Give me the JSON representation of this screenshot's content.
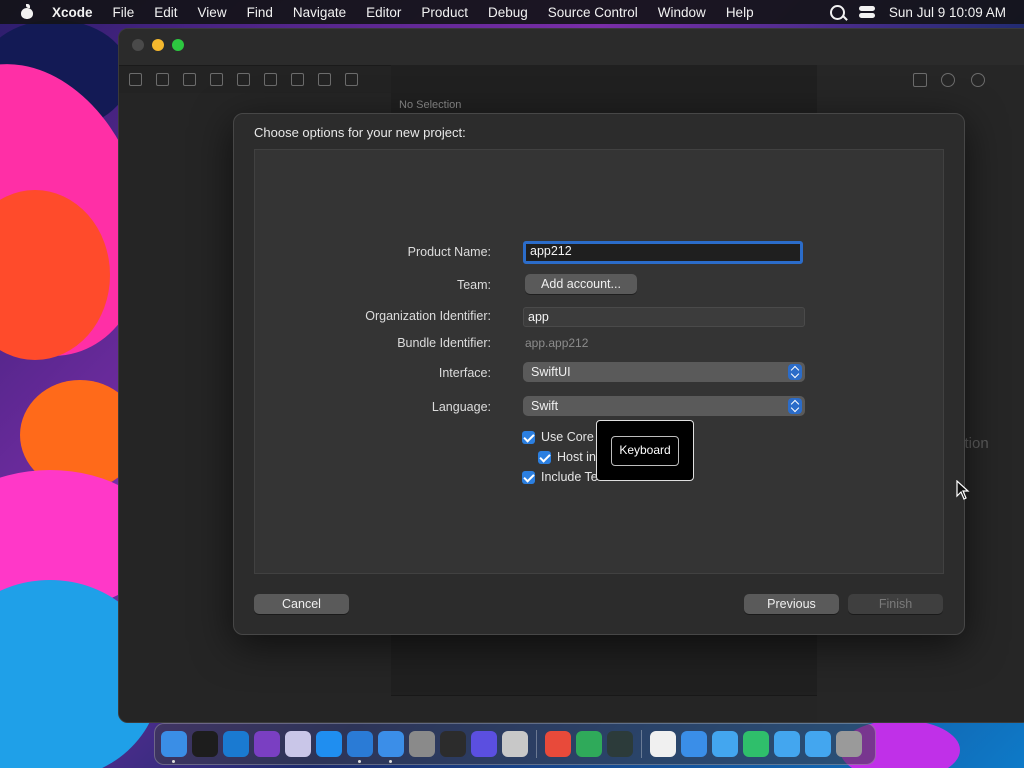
{
  "menubar": {
    "app_name": "Xcode",
    "items": [
      "File",
      "Edit",
      "View",
      "Find",
      "Navigate",
      "Editor",
      "Product",
      "Debug",
      "Source Control",
      "Window",
      "Help"
    ],
    "clock": "Sun Jul 9  10:09 AM"
  },
  "xcode": {
    "center_placeholder": "No Selection",
    "inspector_placeholder": "ction"
  },
  "sheet": {
    "title": "Choose options for your new project:",
    "product_name": {
      "label": "Product Name:",
      "value": "app212"
    },
    "team": {
      "label": "Team:",
      "button": "Add account..."
    },
    "org_id": {
      "label": "Organization Identifier:",
      "value": "app"
    },
    "bundle_id": {
      "label": "Bundle Identifier:",
      "value": "app.app212"
    },
    "interface": {
      "label": "Interface:",
      "value": "SwiftUI"
    },
    "language": {
      "label": "Language:",
      "value": "Swift"
    },
    "checks": [
      {
        "label": "Use Core",
        "checked": true
      },
      {
        "label": "Host in",
        "checked": true
      },
      {
        "label": "Include Te",
        "checked": true
      }
    ],
    "tooltip": "Keyboard",
    "cancel": "Cancel",
    "previous": "Previous",
    "finish": "Finish"
  },
  "dock": {
    "icons": [
      {
        "name": "finder-icon",
        "color": "#3a8ee6"
      },
      {
        "name": "terminal-icon",
        "color": "#1d1d1d"
      },
      {
        "name": "vscode-icon",
        "color": "#1a7ad1"
      },
      {
        "name": "visual-studio-icon",
        "color": "#7a3fc2"
      },
      {
        "name": "bbedit-icon",
        "color": "#c9c6e8"
      },
      {
        "name": "app-store-icon",
        "color": "#1f8ef0"
      },
      {
        "name": "xcode-icon",
        "color": "#2a7bd6"
      },
      {
        "name": "simulator-icon",
        "color": "#3b8ee8"
      },
      {
        "name": "system-settings-icon",
        "color": "#8a8a8a"
      },
      {
        "name": "activity-monitor-icon",
        "color": "#2c2c2c"
      },
      {
        "name": "shortcuts-icon",
        "color": "#5b4fe0"
      },
      {
        "name": "launchpad-icon",
        "color": "#c8c8c8"
      },
      {
        "name": "chrome-icon",
        "color": "#e84a3a"
      },
      {
        "name": "sourcetree-icon",
        "color": "#2faa5a"
      },
      {
        "name": "console-icon",
        "color": "#2c3b3a"
      },
      {
        "name": "document-icon",
        "color": "#f0f0f0"
      },
      {
        "name": "safari-icon",
        "color": "#3a8ee8"
      },
      {
        "name": "folder-icon",
        "color": "#43a6ef"
      },
      {
        "name": "sourcetree-icon",
        "color": "#2fbf6b"
      },
      {
        "name": "folder-icon",
        "color": "#43a6ef"
      },
      {
        "name": "folder-icon",
        "color": "#43a6ef"
      },
      {
        "name": "trash-icon",
        "color": "#9a9a9a"
      }
    ]
  }
}
